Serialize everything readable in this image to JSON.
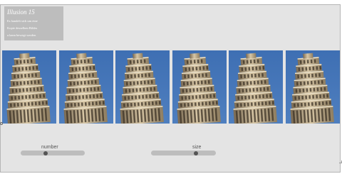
{
  "caption": {
    "title": "Illusion 15",
    "lines": [
      "Es handelt sich um eine",
      "Kopie desselben Bildes",
      "a kann bewegt werden"
    ]
  },
  "images": [
    {
      "alt": "Leaning Tower of Pisa"
    },
    {
      "alt": "Leaning Tower of Pisa"
    },
    {
      "alt": "Leaning Tower of Pisa"
    },
    {
      "alt": "Leaning Tower of Pisa"
    },
    {
      "alt": "Leaning Tower of Pisa"
    },
    {
      "alt": "Leaning Tower of Pisa"
    }
  ],
  "controls": {
    "number": {
      "label": "number",
      "value": 0.38
    },
    "size": {
      "label": "size",
      "value": 0.7
    }
  },
  "colors": {
    "sky": "#4f7fbf",
    "tower": "#d8c7a6"
  }
}
